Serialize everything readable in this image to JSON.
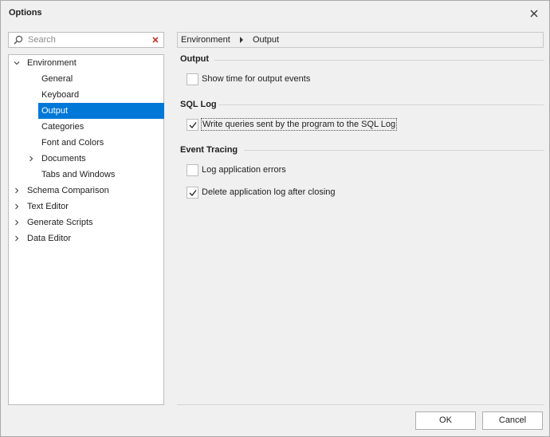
{
  "window": {
    "title": "Options"
  },
  "search": {
    "placeholder": "Search",
    "value": ""
  },
  "tree": {
    "items": [
      {
        "label": "Environment",
        "expanded": true
      },
      {
        "label": "General"
      },
      {
        "label": "Keyboard"
      },
      {
        "label": "Output",
        "selected": true
      },
      {
        "label": "Categories"
      },
      {
        "label": "Font and Colors"
      },
      {
        "label": "Documents",
        "expandable": true
      },
      {
        "label": "Tabs and Windows"
      },
      {
        "label": "Schema Comparison",
        "expandable": true
      },
      {
        "label": "Text Editor",
        "expandable": true
      },
      {
        "label": "Generate Scripts",
        "expandable": true
      },
      {
        "label": "Data Editor",
        "expandable": true
      }
    ]
  },
  "breadcrumb": {
    "items": [
      "Environment",
      "Output"
    ]
  },
  "sections": [
    {
      "title": "Output",
      "options": [
        {
          "label": "Show time for output events",
          "checked": false
        }
      ]
    },
    {
      "title": "SQL Log",
      "options": [
        {
          "label": "Write queries sent by the program to the SQL Log",
          "checked": true
        }
      ]
    },
    {
      "title": "Event Tracing",
      "options": [
        {
          "label": "Log application errors",
          "checked": false
        },
        {
          "label": "Delete application log after closing",
          "checked": true
        }
      ]
    }
  ],
  "buttons": {
    "ok": "OK",
    "cancel": "Cancel"
  },
  "colors": {
    "selection": "#0078d7",
    "background": "#f0f0f0"
  }
}
